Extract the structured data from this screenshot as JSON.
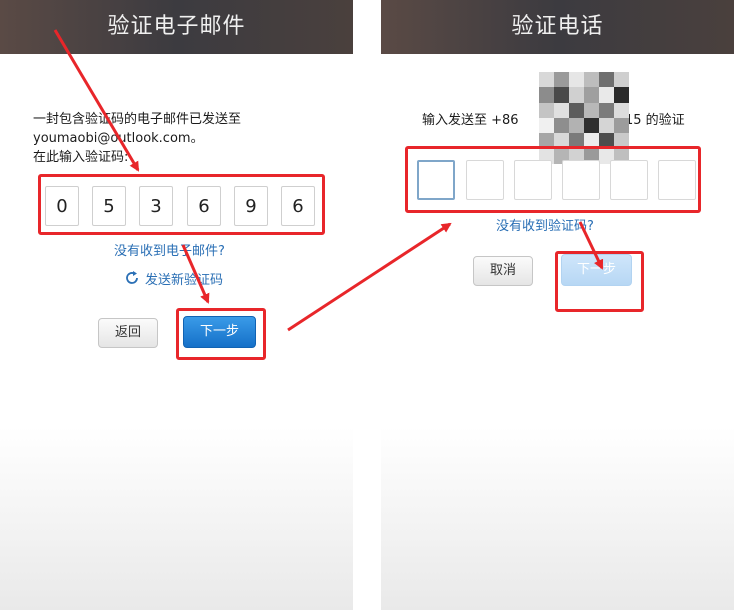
{
  "left": {
    "title": "验证电子邮件",
    "message_line1": "一封包含验证码的电子邮件已发送至",
    "message_line2": "youmaobi@outlook.com。",
    "message_line3": "在此输入验证码:",
    "code_digits": [
      "0",
      "5",
      "3",
      "6",
      "9",
      "6"
    ],
    "no_email_link": "没有收到电子邮件?",
    "resend_link": "发送新验证码",
    "back_button": "返回",
    "next_button": "下一步"
  },
  "right": {
    "title": "验证电话",
    "prompt_prefix": "输入发送至 +86",
    "prompt_suffix": "15 的验证",
    "no_code_link": "没有收到验证码?",
    "cancel_button": "取消",
    "next_button": "下一步"
  },
  "colors": {
    "annotation": "#e8262a",
    "link": "#2a6fb5",
    "primary": "#1570c8",
    "title_bar": "#3f3b3d"
  },
  "icons": {
    "refresh": "refresh-icon",
    "mosaic": "pixelated-redaction"
  }
}
